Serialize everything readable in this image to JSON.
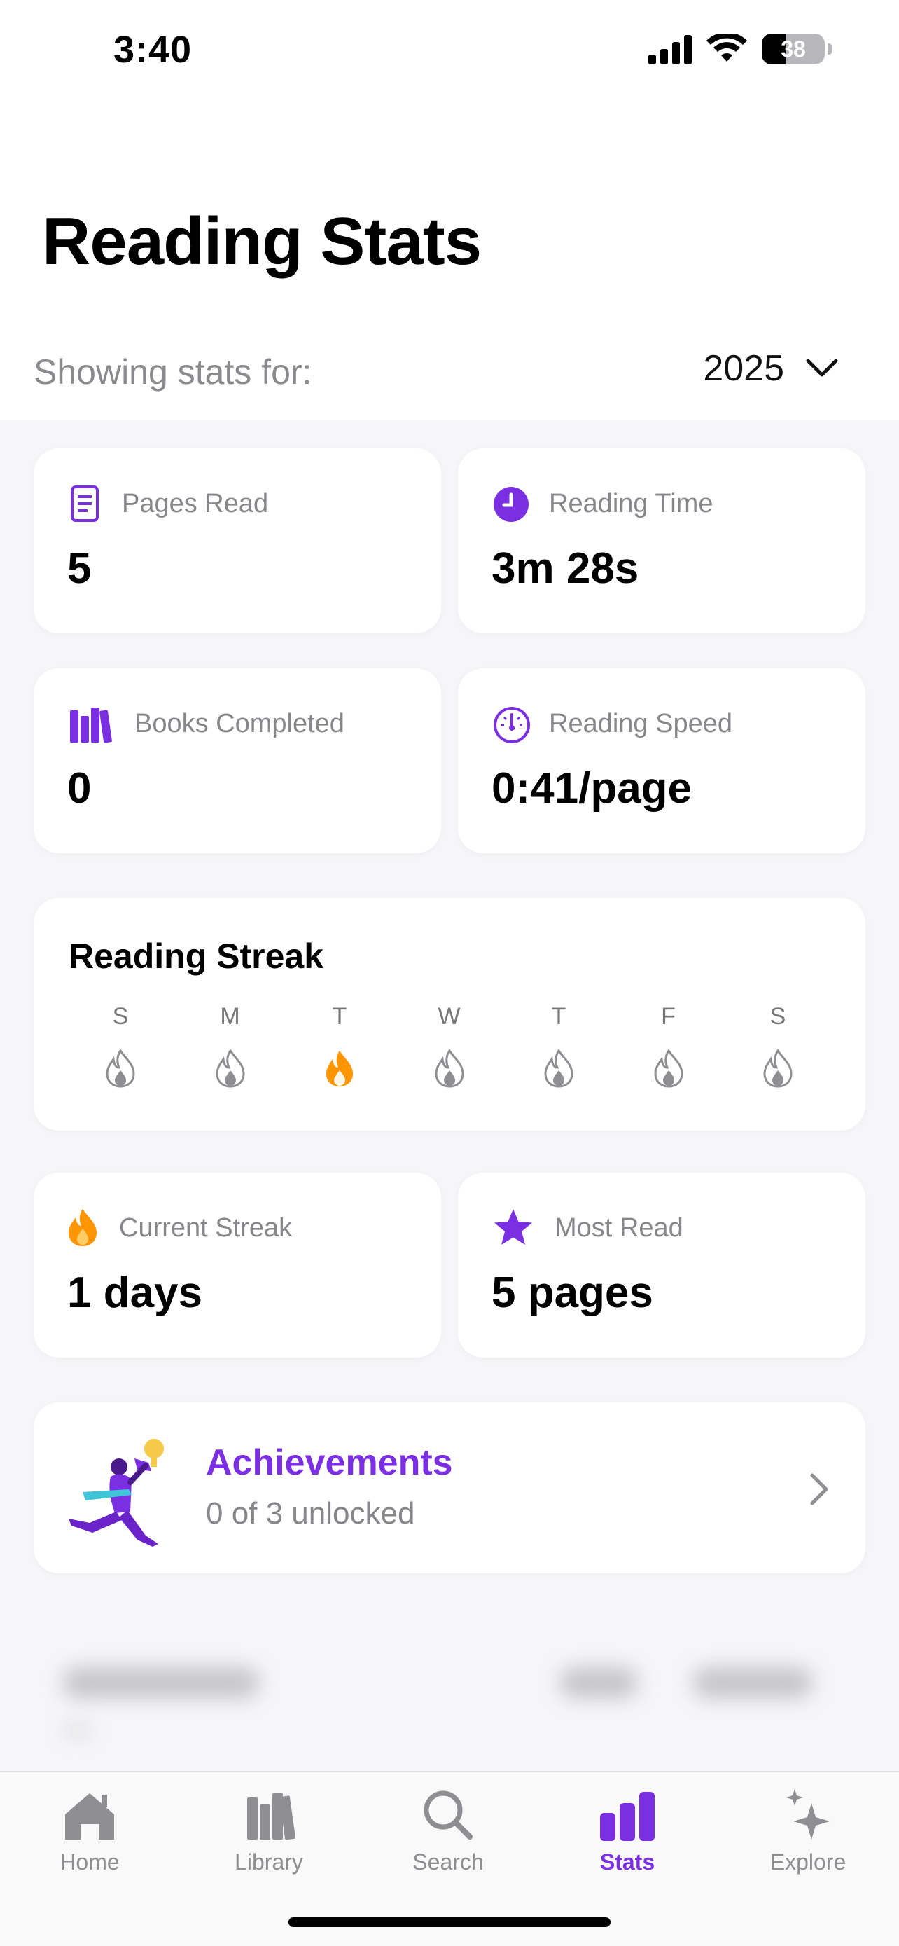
{
  "status_bar": {
    "time": "3:40",
    "battery": "38",
    "battery_level": 0.38
  },
  "header": {
    "title": "Reading Stats",
    "filter_label": "Showing stats for:",
    "year": "2025"
  },
  "stats": {
    "pages_read": {
      "label": "Pages Read",
      "value": "5",
      "icon": "document-icon"
    },
    "reading_time": {
      "label": "Reading Time",
      "value": "3m 28s",
      "icon": "clock-icon"
    },
    "books_completed": {
      "label": "Books Completed",
      "value": "0",
      "icon": "books-icon"
    },
    "reading_speed": {
      "label": "Reading Speed",
      "value": "0:41/page",
      "icon": "speedometer-icon"
    }
  },
  "streak": {
    "title": "Reading Streak",
    "days": [
      {
        "letter": "S",
        "active": false
      },
      {
        "letter": "M",
        "active": false
      },
      {
        "letter": "T",
        "active": true
      },
      {
        "letter": "W",
        "active": false
      },
      {
        "letter": "T",
        "active": false
      },
      {
        "letter": "F",
        "active": false
      },
      {
        "letter": "S",
        "active": false
      }
    ]
  },
  "highlights": {
    "current_streak": {
      "label": "Current Streak",
      "value": "1 days",
      "icon": "flame-icon"
    },
    "most_read": {
      "label": "Most Read",
      "value": "5 pages",
      "icon": "star-icon"
    }
  },
  "achievements": {
    "title": "Achievements",
    "subtitle": "0 of 3 unlocked"
  },
  "tabs": [
    {
      "label": "Home",
      "icon": "house-icon",
      "active": false
    },
    {
      "label": "Library",
      "icon": "books-icon",
      "active": false
    },
    {
      "label": "Search",
      "icon": "magnifier-icon",
      "active": false
    },
    {
      "label": "Stats",
      "icon": "bar-chart-icon",
      "active": true
    },
    {
      "label": "Explore",
      "icon": "sparkles-icon",
      "active": false
    }
  ],
  "colors": {
    "accent": "#7b2fe3",
    "flame_active": "#ff9500",
    "flame_inactive": "#8e8e93"
  }
}
